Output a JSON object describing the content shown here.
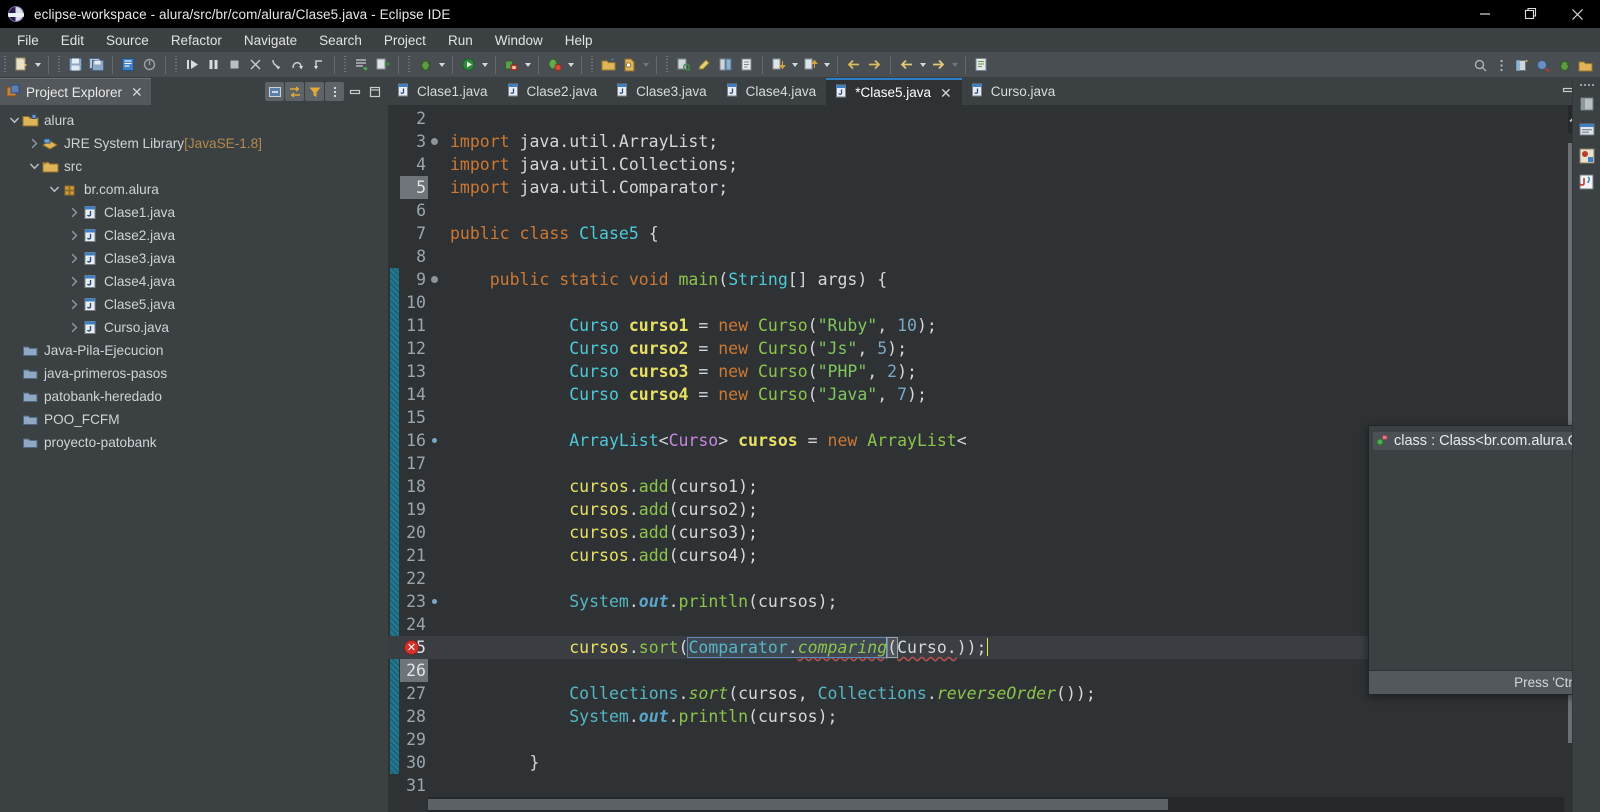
{
  "window": {
    "title": "eclipse-workspace - alura/src/br/com/alura/Clase5.java - Eclipse IDE",
    "logo_name": "eclipse-logo-icon",
    "controls": {
      "minimize": "minimize-button",
      "maximize": "maximize-button",
      "close": "close-button"
    }
  },
  "menubar": {
    "items": [
      "File",
      "Edit",
      "Source",
      "Refactor",
      "Navigate",
      "Search",
      "Project",
      "Run",
      "Window",
      "Help"
    ]
  },
  "toolbar": {
    "groups": [
      {
        "buttons": [
          "new-wizard-icon"
        ],
        "dropdown": true
      },
      {
        "buttons": [
          "save-icon",
          "save-all-icon"
        ]
      },
      {
        "buttons": [
          "print-icon",
          "build-all-icon"
        ]
      },
      {
        "buttons": [
          "resume-icon",
          "suspend-icon",
          "terminate-icon",
          "disconnect-icon",
          "step-into-icon",
          "step-over-icon",
          "step-return-icon"
        ]
      },
      {
        "buttons": [
          "open-type-icon",
          "external-tools-icon"
        ]
      },
      {
        "buttons": [
          "debug-icon"
        ],
        "dropdown": true
      },
      {
        "buttons": [
          "run-icon"
        ],
        "dropdown": true
      },
      {
        "buttons": [
          "run-last-tool-icon"
        ],
        "dropdown": true
      },
      {
        "buttons": [
          "coverage-icon"
        ],
        "dropdown": true
      },
      {
        "buttons": [
          "new-java-project-icon",
          "new-class-icon"
        ],
        "dropdown": true
      },
      {
        "buttons": [
          "search-icon-tb",
          "open-task-icon",
          "toggle-ruler-icon",
          "link-icon"
        ]
      },
      {
        "buttons": [
          "next-annotation-icon"
        ],
        "dropdown": true
      },
      {
        "buttons": [
          "previous-annotation-icon"
        ],
        "dropdown": true
      },
      {
        "buttons": [
          "back-icon",
          "forward-icon"
        ]
      },
      {
        "buttons": [
          "prev-edit-icon"
        ],
        "dropdown": true
      },
      {
        "buttons": [
          "next-edit-icon"
        ],
        "dropdown": true
      },
      {
        "buttons": [
          "new-untitled-text-file-icon"
        ]
      }
    ],
    "right": [
      "quick-access-search-icon",
      "perspective-overflow-icon",
      "open-perspective-icon",
      "java-perspective-icon",
      "debug-perspective-icon",
      "java-browsing-perspective-icon"
    ]
  },
  "explorer": {
    "tab_label": "Project Explorer",
    "tab_icon": "project-explorer-icon",
    "tab_close": "✕",
    "tools": [
      "collapse-all-icon",
      "link-with-editor-icon",
      "view-filter-icon",
      "view-menu-icon",
      "minimize-view-icon",
      "maximize-view-icon"
    ],
    "tree": [
      {
        "indent": 0,
        "chevron": "down",
        "icon": "java-project-icon",
        "label": "alura",
        "suffix": ""
      },
      {
        "indent": 1,
        "chevron": "right",
        "icon": "jre-library-icon",
        "label": "JRE System Library ",
        "suffix": "[JavaSE-1.8]"
      },
      {
        "indent": 1,
        "chevron": "down",
        "icon": "source-folder-icon",
        "label": "src",
        "suffix": ""
      },
      {
        "indent": 2,
        "chevron": "down",
        "icon": "package-icon",
        "label": "br.com.alura",
        "suffix": ""
      },
      {
        "indent": 3,
        "chevron": "right",
        "icon": "java-file-icon",
        "label": "Clase1.java",
        "suffix": ""
      },
      {
        "indent": 3,
        "chevron": "right",
        "icon": "java-file-icon",
        "label": "Clase2.java",
        "suffix": ""
      },
      {
        "indent": 3,
        "chevron": "right",
        "icon": "java-file-icon",
        "label": "Clase3.java",
        "suffix": ""
      },
      {
        "indent": 3,
        "chevron": "right",
        "icon": "java-file-icon",
        "label": "Clase4.java",
        "suffix": ""
      },
      {
        "indent": 3,
        "chevron": "right",
        "icon": "java-file-icon",
        "label": "Clase5.java",
        "suffix": ""
      },
      {
        "indent": 3,
        "chevron": "right",
        "icon": "java-file-icon",
        "label": "Curso.java",
        "suffix": ""
      },
      {
        "indent": 0,
        "chevron": "none",
        "icon": "closed-project-icon",
        "label": "Java-Pila-Ejecucion",
        "suffix": ""
      },
      {
        "indent": 0,
        "chevron": "none",
        "icon": "closed-project-icon",
        "label": "java-primeros-pasos",
        "suffix": ""
      },
      {
        "indent": 0,
        "chevron": "none",
        "icon": "closed-project-icon",
        "label": "patobank-heredado",
        "suffix": ""
      },
      {
        "indent": 0,
        "chevron": "none",
        "icon": "closed-project-icon",
        "label": "POO_FCFM",
        "suffix": ""
      },
      {
        "indent": 0,
        "chevron": "none",
        "icon": "closed-project-icon",
        "label": "proyecto-patobank",
        "suffix": ""
      }
    ]
  },
  "editor": {
    "tabs": [
      {
        "label": "Clase1.java",
        "active": false,
        "dirty": false,
        "closable": false
      },
      {
        "label": "Clase2.java",
        "active": false,
        "dirty": false,
        "closable": false
      },
      {
        "label": "Clase3.java",
        "active": false,
        "dirty": false,
        "closable": false
      },
      {
        "label": "Clase4.java",
        "active": false,
        "dirty": false,
        "closable": false
      },
      {
        "label": "*Clase5.java",
        "active": true,
        "dirty": true,
        "closable": true
      },
      {
        "label": "Curso.java",
        "active": false,
        "dirty": false,
        "closable": false
      }
    ],
    "tab_icon": "java-file-icon",
    "lines": [
      {
        "num": "2",
        "code": ""
      },
      {
        "num": "3",
        "code": "import java.util.ArrayList;"
      },
      {
        "num": "4",
        "code": "import java.util.Collections;"
      },
      {
        "num": "5",
        "code": "import java.util.Comparator;"
      },
      {
        "num": "6",
        "code": ""
      },
      {
        "num": "7",
        "code": "public class Clase5 {"
      },
      {
        "num": "8",
        "code": ""
      },
      {
        "num": "9",
        "code": "    public static void main(String[] args) {"
      },
      {
        "num": "10",
        "code": ""
      },
      {
        "num": "11",
        "code": "            Curso curso1 = new Curso(\"Ruby\", 10);"
      },
      {
        "num": "12",
        "code": "            Curso curso2 = new Curso(\"Js\", 5);"
      },
      {
        "num": "13",
        "code": "            Curso curso3 = new Curso(\"PHP\", 2);"
      },
      {
        "num": "14",
        "code": "            Curso curso4 = new Curso(\"Java\", 7);"
      },
      {
        "num": "15",
        "code": ""
      },
      {
        "num": "16",
        "code": "            ArrayList<Curso> cursos = new ArrayList<"
      },
      {
        "num": "17",
        "code": ""
      },
      {
        "num": "18",
        "code": "            cursos.add(curso1);"
      },
      {
        "num": "19",
        "code": "            cursos.add(curso2);"
      },
      {
        "num": "20",
        "code": "            cursos.add(curso3);"
      },
      {
        "num": "21",
        "code": "            cursos.add(curso4);"
      },
      {
        "num": "22",
        "code": ""
      },
      {
        "num": "23",
        "code": "            System.out.println(cursos);"
      },
      {
        "num": "24",
        "code": ""
      },
      {
        "num": "25",
        "code": "            cursos.sort(Comparator.comparing(Curso.));"
      },
      {
        "num": "26",
        "code": ""
      },
      {
        "num": "27",
        "code": "            Collections.sort(cursos, Collections.reverseOrder());"
      },
      {
        "num": "28",
        "code": "            System.out.println(cursos);"
      },
      {
        "num": "29",
        "code": ""
      },
      {
        "num": "30",
        "code": "        }"
      },
      {
        "num": "31",
        "code": ""
      }
    ],
    "error_marker": {
      "line": "25",
      "icon": "error-marker-icon",
      "glyph": "✕"
    },
    "toolbar_right": [
      "minimize-editor-icon",
      "maximize-editor-icon"
    ]
  },
  "content_assist": {
    "proposals": [
      {
        "icon": "public-field-icon",
        "label": "class : Class<br.com.alura.Curso>",
        "selected": true
      }
    ],
    "footer": "Press 'Ctrl+Space' to show Template Proposals"
  },
  "fastbar": {
    "icons": [
      "overflow-dots-icon",
      "open-perspective-icon",
      "java-perspective-icon",
      "debug-perspective-icon",
      "java-browsing-perspective-icon"
    ]
  },
  "colors": {
    "titlebar_bg": "#000000",
    "chrome_bg": "#3b4042",
    "toolbar_bg": "#494e52",
    "editor_bg": "#2f3235",
    "active_tab_accent": "#2a7fc9",
    "keyword": "#cc7832",
    "type": "#4ec9d6",
    "generic": "#c586dd",
    "variable": "#e8e063",
    "method": "#8cc44b",
    "string": "#7fc65e",
    "number": "#7aa8c4",
    "static_field": "#5aa6c8",
    "change_bar": "#1d6d82",
    "error_red": "#d2332b",
    "caret": "#d6ef4d"
  }
}
